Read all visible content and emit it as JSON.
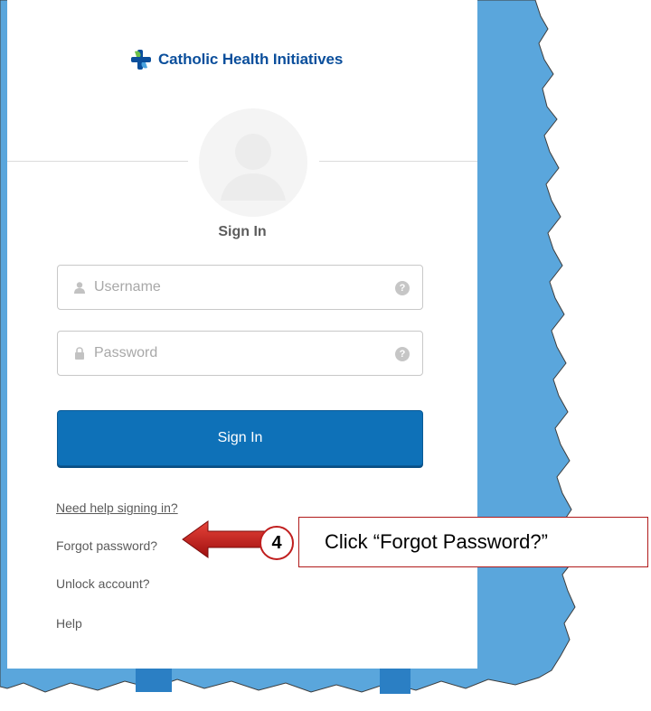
{
  "brand": {
    "name": "Catholic Health Initiatives",
    "color": "#0b4f9c",
    "accent_green": "#6cc04a"
  },
  "icons": {
    "logo": "cross-mark-icon",
    "avatar": "user-silhouette-icon",
    "username": "user-icon",
    "password": "lock-icon",
    "help": "question-circle-icon",
    "arrow": "left-arrow-icon"
  },
  "form": {
    "title": "Sign In",
    "username": {
      "value": "",
      "placeholder": "Username",
      "help": "?"
    },
    "password": {
      "value": "",
      "placeholder": "Password",
      "help": "?"
    },
    "submit_label": "Sign In",
    "submit_color": "#0e71b8"
  },
  "links": {
    "need_help": "Need help signing in?",
    "forgot": "Forgot password?",
    "unlock": "Unlock account?",
    "help": "Help"
  },
  "annotation": {
    "step": "4",
    "text": "Click “Forgot Password?”",
    "color": "#c01e1e"
  },
  "background_color": "#5aa6dc"
}
